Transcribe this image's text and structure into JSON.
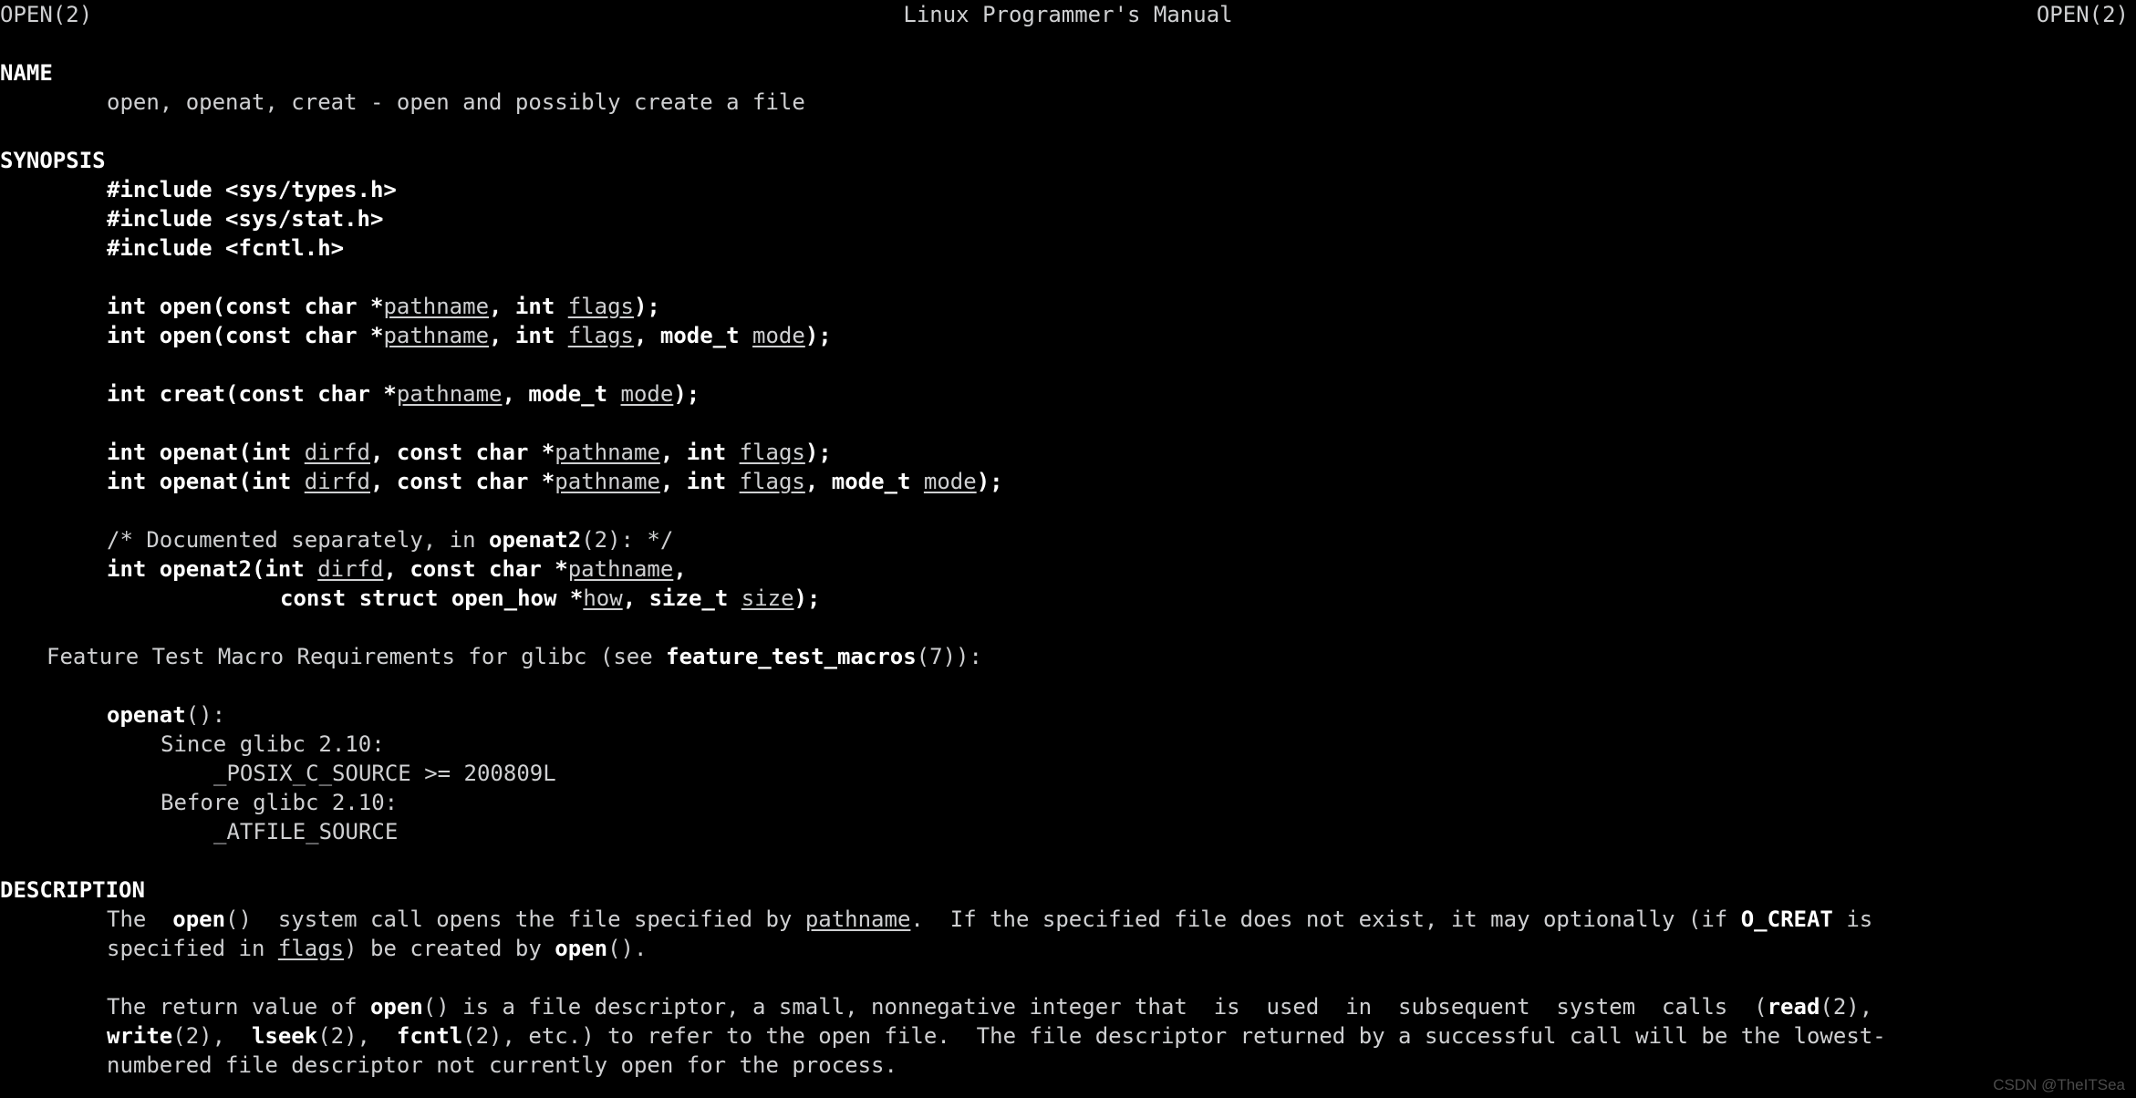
{
  "terminal": {
    "background_color": "#000000",
    "text_color": "#cfd0d2",
    "bold_color": "#ffffff",
    "watermark": "CSDN @TheITSea"
  },
  "header": {
    "left": "OPEN(2)",
    "center": "Linux Programmer's Manual",
    "right": "OPEN(2)"
  },
  "sections": {
    "name_heading": "NAME",
    "name_body": "open, openat, creat - open and possibly create a file",
    "synopsis_heading": "SYNOPSIS",
    "description_heading": "DESCRIPTION"
  },
  "synopsis": {
    "include_1": "#include <sys/types.h>",
    "include_2": "#include <sys/stat.h>",
    "include_3": "#include <fcntl.h>",
    "open_1": {
      "pre": "int open(const char *",
      "p1": "pathname",
      "mid1": ", int ",
      "p2": "flags",
      "post": ");"
    },
    "open_2": {
      "pre": "int open(const char *",
      "p1": "pathname",
      "mid1": ", int ",
      "p2": "flags",
      "mid2": ", mode_t ",
      "p3": "mode",
      "post": ");"
    },
    "creat": {
      "pre": "int creat(const char *",
      "p1": "pathname",
      "mid1": ", mode_t ",
      "p2": "mode",
      "post": ");"
    },
    "openat_1": {
      "pre": "int openat(int ",
      "p1": "dirfd",
      "mid1": ", const char *",
      "p2": "pathname",
      "mid2": ", int ",
      "p3": "flags",
      "post": ");"
    },
    "openat_2": {
      "pre": "int openat(int ",
      "p1": "dirfd",
      "mid1": ", const char *",
      "p2": "pathname",
      "mid2": ", int ",
      "p3": "flags",
      "mid3": ", mode_t ",
      "p4": "mode",
      "post": ");"
    },
    "comment": {
      "pre": "/* Documented separately, in ",
      "bold": "openat2",
      "post": "(2): */"
    },
    "openat2_line1": {
      "pre": "int openat2(int ",
      "p1": "dirfd",
      "mid1": ", const char *",
      "p2": "pathname",
      "post": ","
    },
    "openat2_line2": {
      "pre": "const struct open_how *",
      "p1": "how",
      "mid1": ", size_t ",
      "p2": "size",
      "post": ");"
    },
    "feature_test": {
      "pre": "Feature Test Macro Requirements for glibc (see ",
      "bold": "feature_test_macros",
      "post": "(7)):"
    },
    "openat_label": {
      "bold": "openat",
      "post": "():"
    },
    "since_glibc": "Since glibc 2.10:",
    "since_glibc_value": "_POSIX_C_SOURCE >= 200809L",
    "before_glibc": "Before glibc 2.10:",
    "before_glibc_value": "_ATFILE_SOURCE"
  },
  "description": {
    "para1_line1": {
      "t1": "The  ",
      "b1": "open",
      "t2": "()  system call opens the file specified by ",
      "u1": "pathname",
      "t3": ".  If the specified file does not exist, it may optionally (if ",
      "b2": "O_CREAT",
      "t4": " is"
    },
    "para1_line2": {
      "t1": "specified in ",
      "u1": "flags",
      "t2": ") be created by ",
      "b1": "open",
      "t3": "()."
    },
    "para2_line1": {
      "t1": "The return value of ",
      "b1": "open",
      "t2": "() is a file descriptor, a small, nonnegative integer that  is  used  in  subsequent  system  calls  (",
      "b2": "read",
      "t3": "(2),"
    },
    "para2_line2": {
      "b1": "write",
      "t1": "(2),  ",
      "b2": "lseek",
      "t2": "(2),  ",
      "b3": "fcntl",
      "t3": "(2), etc.) to refer to the open file.  The file descriptor returned by a successful call will be the lowest-"
    },
    "para2_line3": "numbered file descriptor not currently open for the process."
  }
}
